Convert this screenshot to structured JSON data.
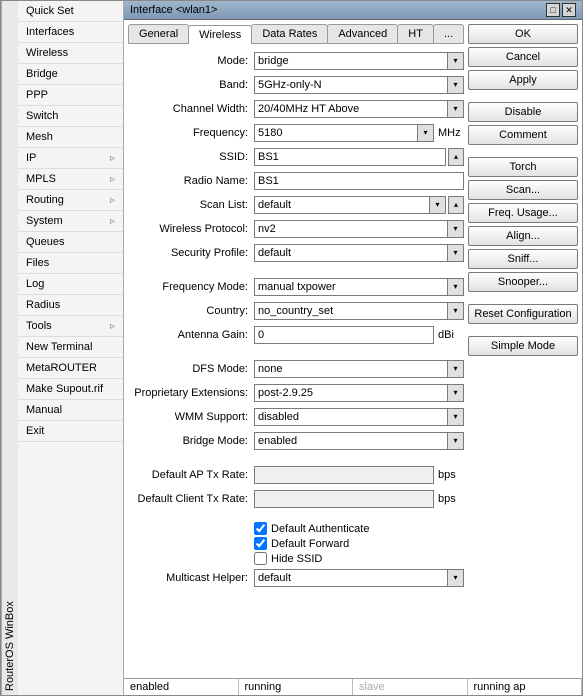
{
  "app_title": "RouterOS WinBox",
  "sidebar": {
    "items": [
      {
        "label": "Quick Set",
        "sub": false
      },
      {
        "label": "Interfaces",
        "sub": false
      },
      {
        "label": "Wireless",
        "sub": false
      },
      {
        "label": "Bridge",
        "sub": false
      },
      {
        "label": "PPP",
        "sub": false
      },
      {
        "label": "Switch",
        "sub": false
      },
      {
        "label": "Mesh",
        "sub": false
      },
      {
        "label": "IP",
        "sub": true
      },
      {
        "label": "MPLS",
        "sub": true
      },
      {
        "label": "Routing",
        "sub": true
      },
      {
        "label": "System",
        "sub": true
      },
      {
        "label": "Queues",
        "sub": false
      },
      {
        "label": "Files",
        "sub": false
      },
      {
        "label": "Log",
        "sub": false
      },
      {
        "label": "Radius",
        "sub": false
      },
      {
        "label": "Tools",
        "sub": true
      },
      {
        "label": "New Terminal",
        "sub": false
      },
      {
        "label": "MetaROUTER",
        "sub": false
      },
      {
        "label": "Make Supout.rif",
        "sub": false
      },
      {
        "label": "Manual",
        "sub": false
      },
      {
        "label": "Exit",
        "sub": false
      }
    ]
  },
  "window": {
    "title": "Interface <wlan1>"
  },
  "tabs": [
    "General",
    "Wireless",
    "Data Rates",
    "Advanced",
    "HT",
    "..."
  ],
  "active_tab": "Wireless",
  "fields": {
    "mode": {
      "label": "Mode:",
      "value": "bridge"
    },
    "band": {
      "label": "Band:",
      "value": "5GHz-only-N"
    },
    "channel_width": {
      "label": "Channel Width:",
      "value": "20/40MHz HT Above"
    },
    "frequency": {
      "label": "Frequency:",
      "value": "5180",
      "unit": "MHz"
    },
    "ssid": {
      "label": "SSID:",
      "value": "BS1"
    },
    "radio_name": {
      "label": "Radio Name:",
      "value": "BS1"
    },
    "scan_list": {
      "label": "Scan List:",
      "value": "default"
    },
    "wireless_protocol": {
      "label": "Wireless Protocol:",
      "value": "nv2"
    },
    "security_profile": {
      "label": "Security Profile:",
      "value": "default"
    },
    "frequency_mode": {
      "label": "Frequency Mode:",
      "value": "manual txpower"
    },
    "country": {
      "label": "Country:",
      "value": "no_country_set"
    },
    "antenna_gain": {
      "label": "Antenna Gain:",
      "value": "0",
      "unit": "dBi"
    },
    "dfs_mode": {
      "label": "DFS Mode:",
      "value": "none"
    },
    "proprietary_ext": {
      "label": "Proprietary Extensions:",
      "value": "post-2.9.25"
    },
    "wmm_support": {
      "label": "WMM Support:",
      "value": "disabled"
    },
    "bridge_mode": {
      "label": "Bridge Mode:",
      "value": "enabled"
    },
    "default_ap_tx": {
      "label": "Default AP Tx Rate:",
      "value": "",
      "unit": "bps"
    },
    "default_client_tx": {
      "label": "Default Client Tx Rate:",
      "value": "",
      "unit": "bps"
    },
    "multicast_helper": {
      "label": "Multicast Helper:",
      "value": "default"
    }
  },
  "checkboxes": {
    "default_authenticate": {
      "label": "Default Authenticate",
      "checked": true
    },
    "default_forward": {
      "label": "Default Forward",
      "checked": true
    },
    "hide_ssid": {
      "label": "Hide SSID",
      "checked": false
    }
  },
  "buttons": [
    "OK",
    "Cancel",
    "Apply",
    "Disable",
    "Comment",
    "Torch",
    "Scan...",
    "Freq. Usage...",
    "Align...",
    "Sniff...",
    "Snooper...",
    "Reset Configuration",
    "Simple Mode"
  ],
  "status": {
    "c1": "enabled",
    "c2": "running",
    "c3": "slave",
    "c4": "running ap"
  }
}
